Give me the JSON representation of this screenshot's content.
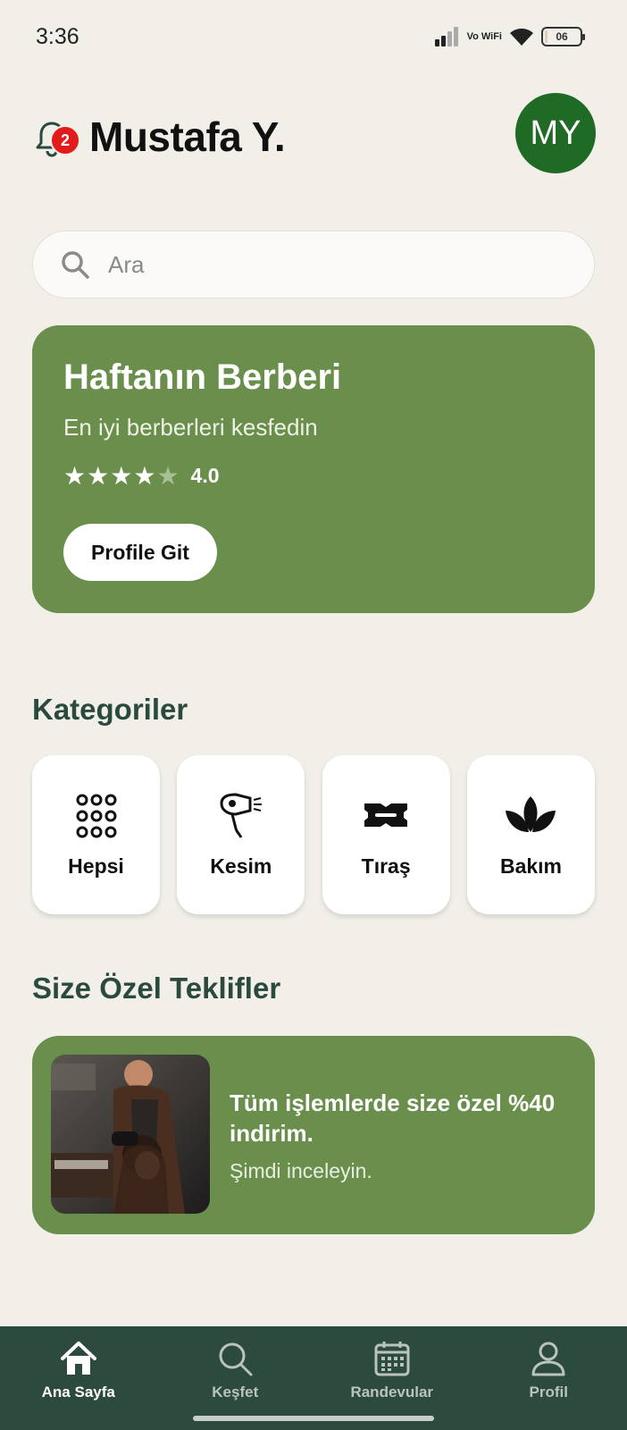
{
  "status_bar": {
    "time": "3:36",
    "network": "Vo WiFi",
    "battery": "06",
    "battery_level": 0.06
  },
  "header": {
    "user_name": "Mustafa Y.",
    "avatar_initials": "MY",
    "notification_count": "2"
  },
  "search": {
    "placeholder": "Ara"
  },
  "featured": {
    "title": "Haftanın Berberi",
    "subtitle": "En iyi berberleri kesfedin",
    "rating": "4.0",
    "stars_filled": 4,
    "button_label": "Profile Git"
  },
  "categories": {
    "title": "Kategoriler",
    "items": [
      {
        "label": "Hepsi",
        "icon": "grid-dots-icon"
      },
      {
        "label": "Kesim",
        "icon": "hair-dryer-icon"
      },
      {
        "label": "Tıraş",
        "icon": "razor-blade-icon"
      },
      {
        "label": "Bakım",
        "icon": "lotus-leaf-icon"
      }
    ]
  },
  "offers": {
    "title": "Size Özel Teklifler",
    "items": [
      {
        "title": "Tüm işlemlerde size özel %40 indirim.",
        "subtitle": "Şimdi inceleyin."
      }
    ]
  },
  "tabbar": {
    "items": [
      {
        "label": "Ana Sayfa",
        "icon": "home-icon",
        "active": true
      },
      {
        "label": "Keşfet",
        "icon": "search-icon",
        "active": false
      },
      {
        "label": "Randevular",
        "icon": "calendar-icon",
        "active": false
      },
      {
        "label": "Profil",
        "icon": "user-icon",
        "active": false
      }
    ]
  },
  "colors": {
    "background": "#f2efe9",
    "card_green": "#6a8f4c",
    "avatar_green": "#1f6a25",
    "tabbar": "#2d4a3e",
    "section_title": "#2b4a3e",
    "badge_red": "#e11b1b"
  }
}
